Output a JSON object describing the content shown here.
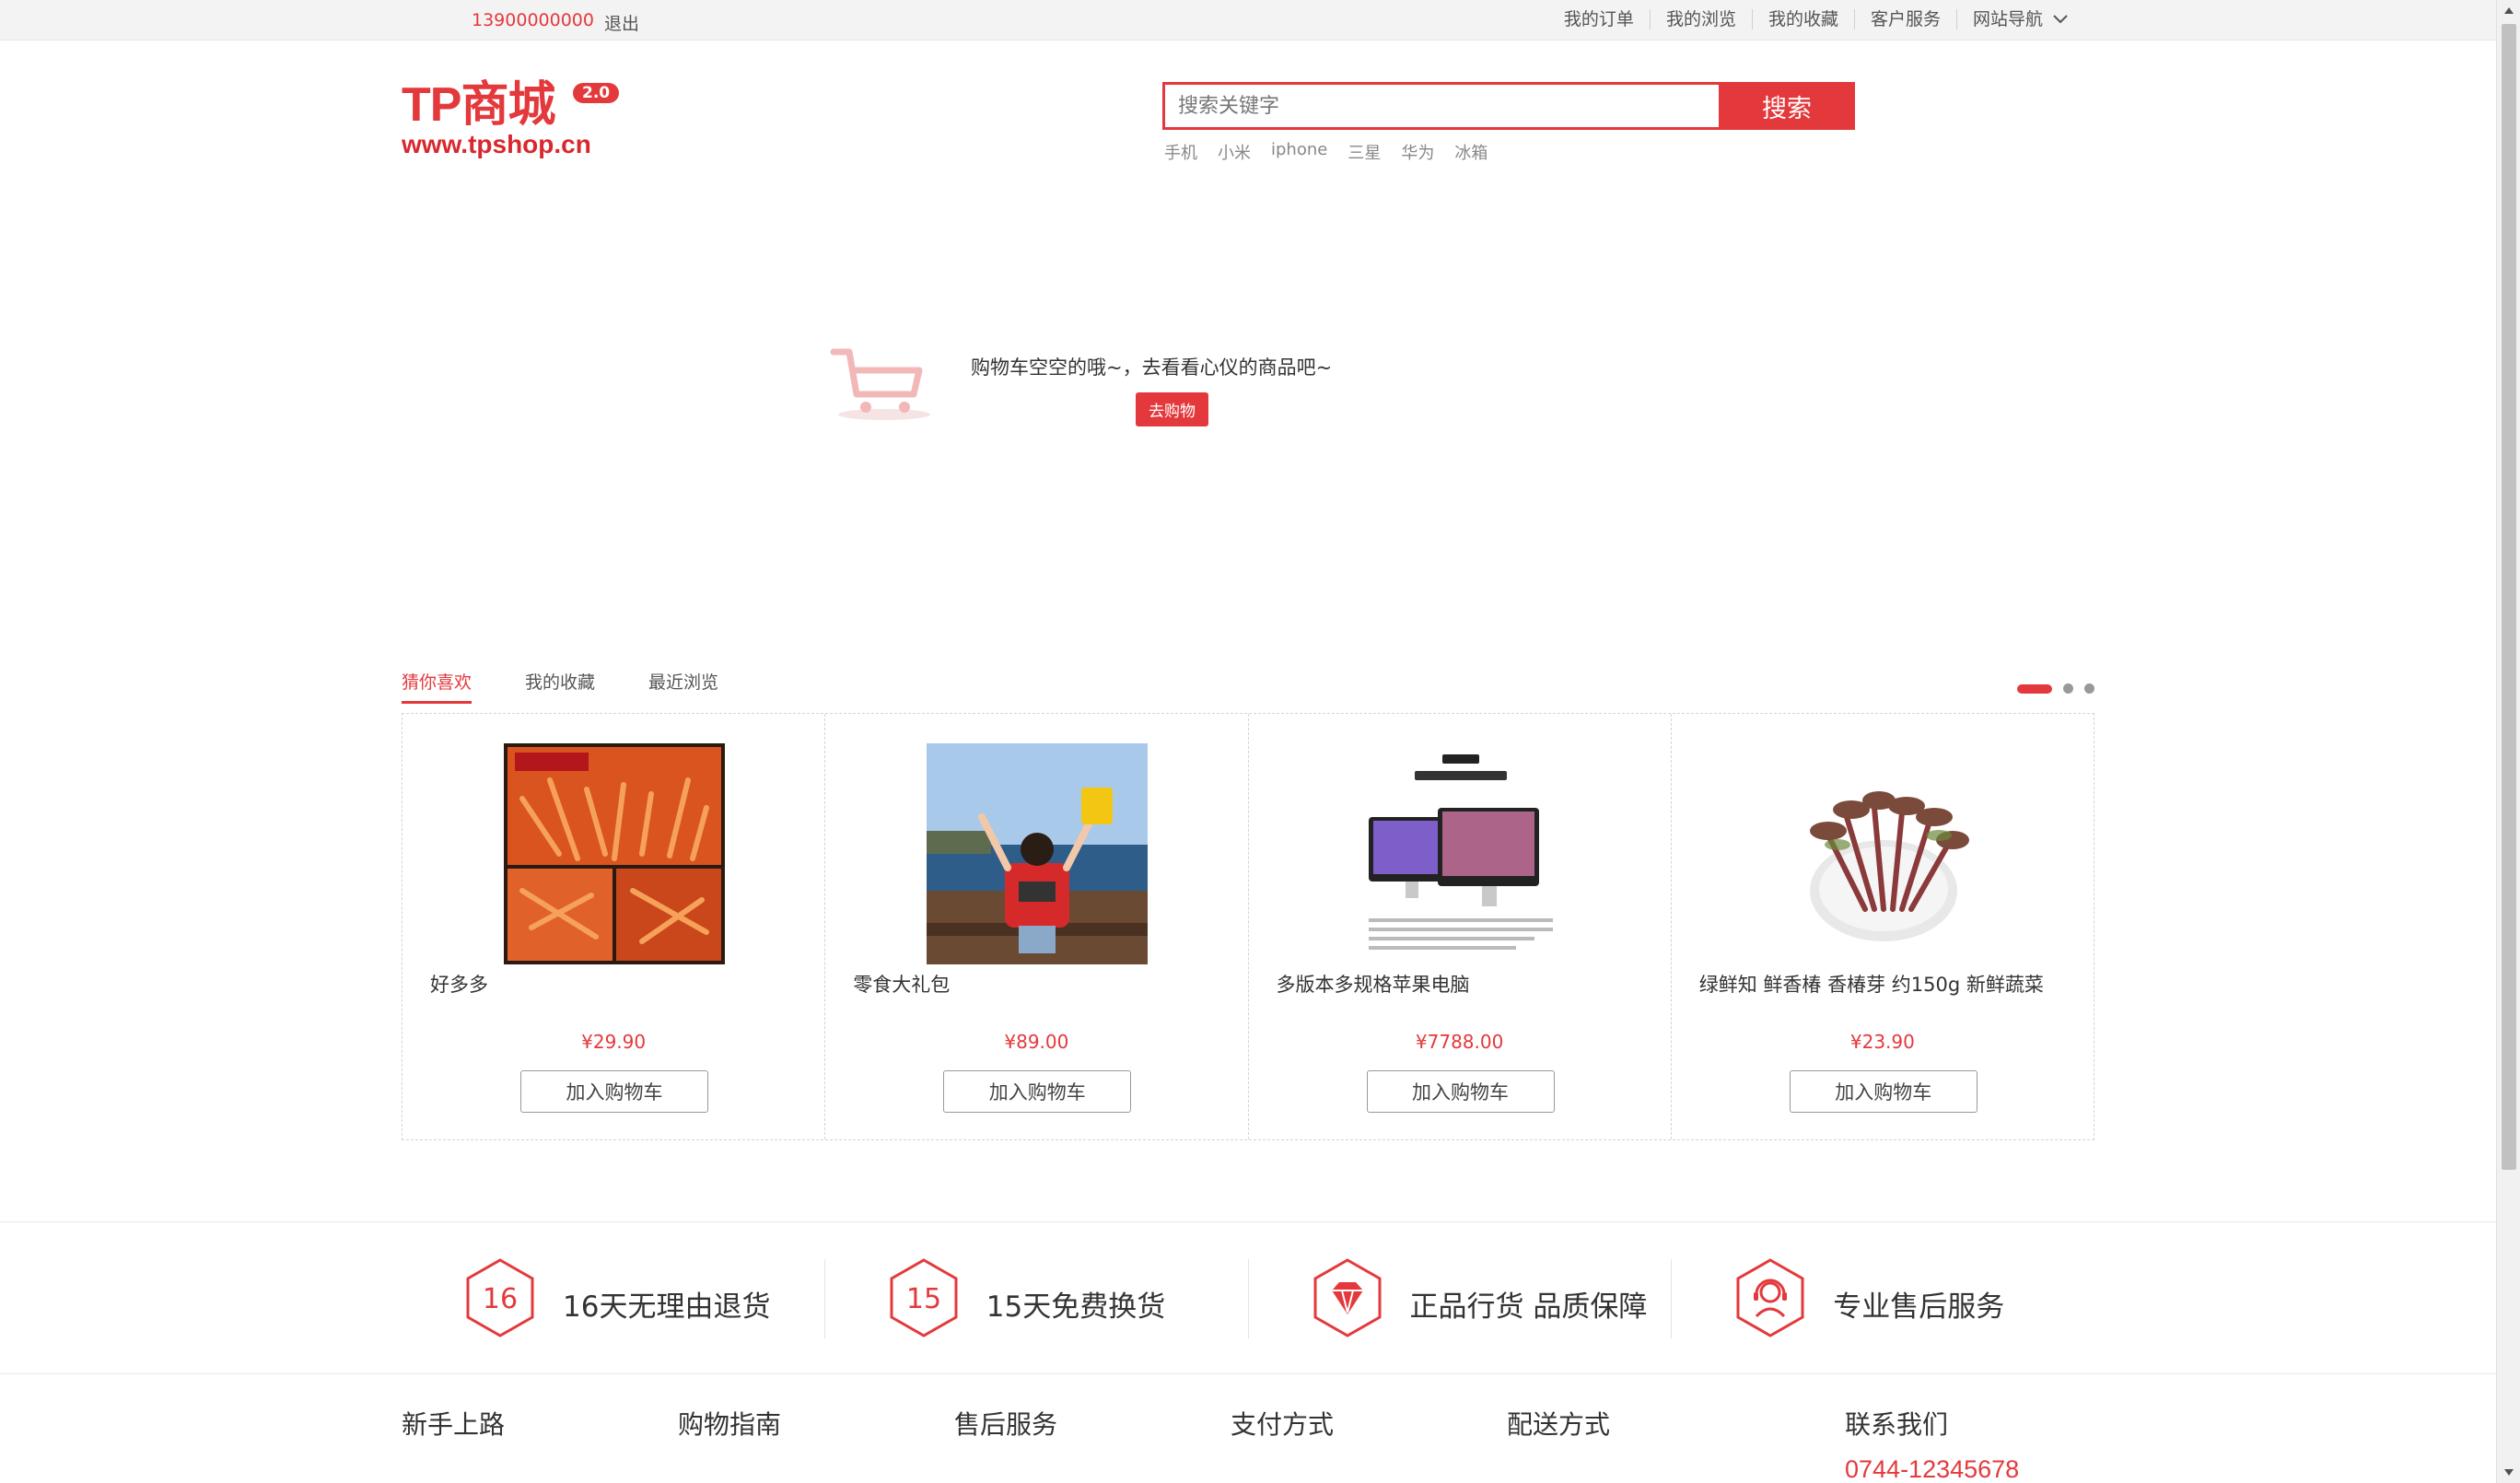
{
  "topbar": {
    "phone": "13900000000",
    "logout": "退出",
    "links": [
      "我的订单",
      "我的浏览",
      "我的收藏",
      "客户服务"
    ],
    "site_nav": "网站导航"
  },
  "logo": {
    "brand": "TP商城",
    "version": "2.0",
    "url": "www.tpshop.cn"
  },
  "search": {
    "placeholder": "搜索关键字",
    "button": "搜索",
    "hotwords": [
      "手机",
      "小米",
      "iphone",
      "三星",
      "华为",
      "冰箱"
    ]
  },
  "cart": {
    "empty_message": "购物车空空的哦~，去看看心仪的商品吧~",
    "go_shopping": "去购物"
  },
  "recommend": {
    "tabs": [
      "猜你喜欢",
      "我的收藏",
      "最近浏览"
    ],
    "active_tab": 0,
    "carousel_pages": 3,
    "carousel_active": 0,
    "products": [
      {
        "name": "好多多",
        "price": "¥29.90",
        "add_label": "加入购物车",
        "image": "spicy-snack-image"
      },
      {
        "name": "零食大礼包",
        "price": "¥89.00",
        "add_label": "加入购物车",
        "image": "girl-at-sea-image"
      },
      {
        "name": "多版本多规格苹果电脑",
        "price": "¥7788.00",
        "add_label": "加入购物车",
        "image": "imac-image"
      },
      {
        "name": "绿鲜知 鲜香椿 香椿芽 约150g 新鲜蔬菜",
        "price": "¥23.90",
        "add_label": "加入购物车",
        "image": "toona-sprout-image"
      }
    ]
  },
  "services": [
    {
      "badge": "16",
      "text": "16天无理由退货",
      "icon": "badge-16-icon"
    },
    {
      "badge": "15",
      "text": "15天免费换货",
      "icon": "badge-15-icon"
    },
    {
      "badge": "",
      "text": "正品行货 品质保障",
      "icon": "diamond-icon"
    },
    {
      "badge": "",
      "text": "专业售后服务",
      "icon": "support-agent-icon"
    }
  ],
  "footer": {
    "columns": [
      "新手上路",
      "购物指南",
      "售后服务",
      "支付方式",
      "配送方式",
      "联系我们"
    ],
    "phone": "0744-12345678"
  },
  "colors": {
    "accent": "#e4393c"
  }
}
